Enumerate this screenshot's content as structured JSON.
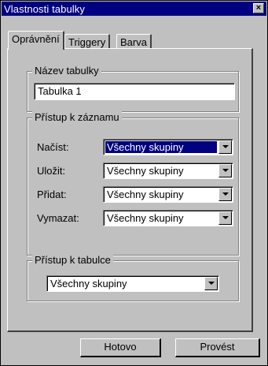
{
  "window": {
    "title": "Vlastnosti tabulky",
    "close_glyph": "×"
  },
  "tabs": [
    {
      "label": "Oprávnění",
      "active": true
    },
    {
      "label": "Triggery",
      "active": false
    },
    {
      "label": "Barva",
      "active": false
    }
  ],
  "table_name_group": {
    "legend": "Název tabulky",
    "value": "Tabulka 1"
  },
  "record_access_group": {
    "legend": "Přístup k záznamu",
    "rows": [
      {
        "label": "Načíst:",
        "value": "Všechny skupiny",
        "selected": true
      },
      {
        "label": "Uložit:",
        "value": "Všechny skupiny",
        "selected": false
      },
      {
        "label": "Přidat:",
        "value": "Všechny skupiny",
        "selected": false
      },
      {
        "label": "Vymazat:",
        "value": "Všechny skupiny",
        "selected": false
      }
    ]
  },
  "table_access_group": {
    "legend": "Přístup k tabulce",
    "value": "Všechny skupiny"
  },
  "buttons": {
    "done": "Hotovo",
    "apply": "Provést"
  },
  "colors": {
    "titlebar": "#000080",
    "face": "#c0c0c0",
    "selection": "#000080"
  }
}
